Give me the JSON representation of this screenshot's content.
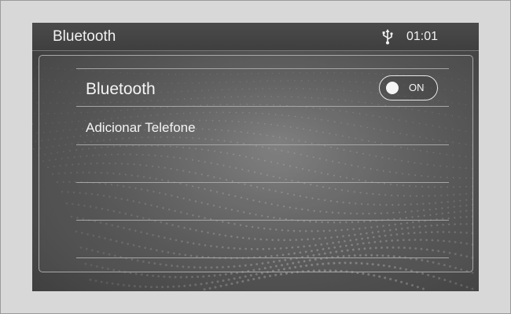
{
  "header": {
    "title": "Bluetooth",
    "usb_icon": "usb-icon",
    "time": "01:01"
  },
  "list": {
    "bluetooth_label": "Bluetooth",
    "toggle_state": "ON",
    "toggle_on": true,
    "add_phone_label": "Adicionar Telefone",
    "empty_rows": 3
  },
  "colors": {
    "screen_bg": "#555555",
    "text": "#f2f2f2",
    "divider": "#a6a6a6",
    "frame_bg": "#d8d8d8"
  }
}
